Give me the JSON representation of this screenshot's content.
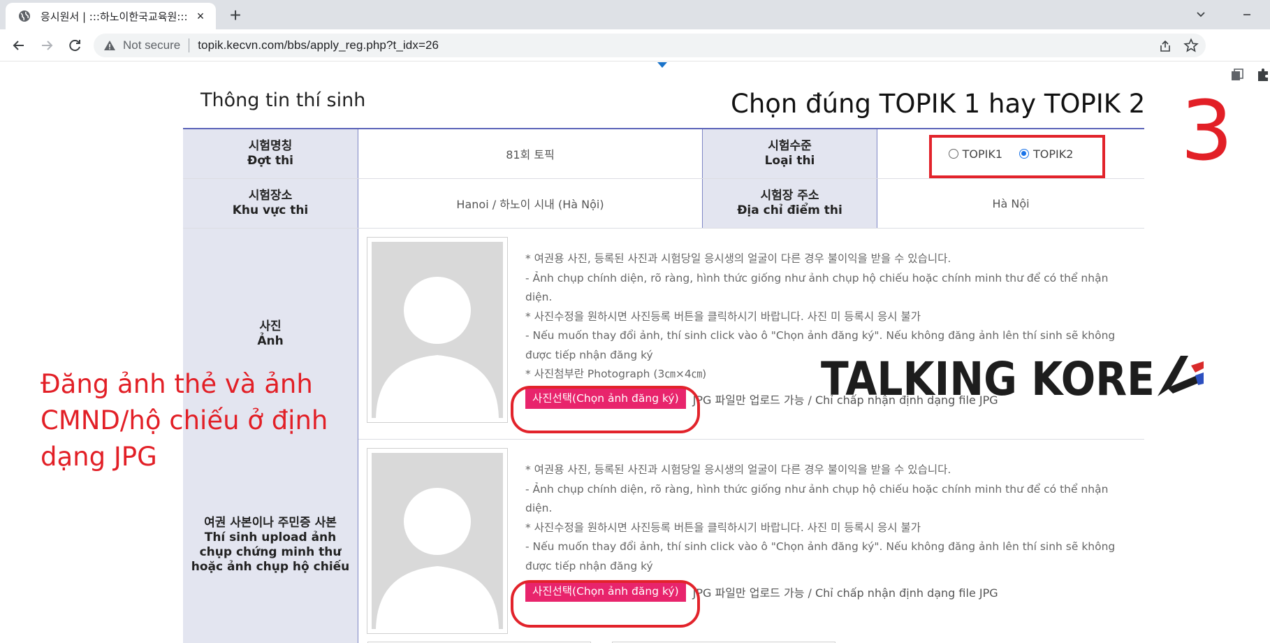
{
  "browser": {
    "tab_title": "응시원서 | :::하노이한국교육원:::",
    "tab_close": "×",
    "new_tab": "+",
    "not_secure": "Not secure",
    "url": "topik.kecvn.com/bbs/apply_reg.php?t_idx=26"
  },
  "page": {
    "section_title": "Thông tin thí sinh",
    "fields": {
      "exam_name_ko": "시험명칭",
      "exam_name_vi": "Đợt thi",
      "exam_name_value": "81회 토픽",
      "level_ko": "시험수준",
      "level_vi": "Loại thi",
      "level_options": [
        "TOPIK1",
        "TOPIK2"
      ],
      "level_selected": "TOPIK2",
      "area_ko": "시험장소",
      "area_vi": "Khu vực thi",
      "area_value": "Hanoi / 하노이 시내 (Hà Nội)",
      "address_ko": "시험장 주소",
      "address_vi": "Địa chỉ điểm thi",
      "address_value": "Hà Nội"
    },
    "photo_section": {
      "label_ko": "사진",
      "label_vi": "Ảnh",
      "notes": [
        "* 여권용 사진, 등록된 사진과 시험당일 응시생의 얼굴이 다른 경우 불이익을 받을 수 있습니다.",
        "- Ảnh chụp chính diện, rõ ràng, hình thức giống như ảnh chụp hộ chiếu hoặc chính minh thư để có thể nhận diện.",
        "* 사진수정을 원하시면 사진등록 버튼을 클릭하시기 바랍니다. 사진 미 등록시 응시 불가",
        "- Nếu muốn thay đổi ảnh, thí sinh click vào ô \"Chọn ảnh đăng ký\". Nếu không đăng ảnh lên thí sinh sẽ không được tiếp nhận đăng ký",
        "* 사진첨부란 Photograph (3㎝×4㎝)"
      ],
      "upload_button": "사진선택(Chọn ảnh đăng ký)",
      "upload_hint": "JPG 파일만 업로드 가능 / Chỉ chấp nhận định dạng file JPG"
    },
    "id_section": {
      "label_ko": "여권 사본이나 주민증 사본",
      "label_vi": "Thí sinh upload ảnh chụp chứng minh thư hoặc ảnh chụp hộ chiếu",
      "notes": [
        "* 여권용 사진, 등록된 사진과 시험당일 응시생의 얼굴이 다른 경우 불이익을 받을 수 있습니다.",
        "- Ảnh chụp chính diện, rõ ràng, hình thức giống như ảnh chụp hộ chiếu hoặc chính minh thư để có thể nhận diện.",
        "* 사진수정을 원하시면 사진등록 버튼을 클릭하시기 바랍니다. 사진 미 등록시 응시 불가",
        "- Nếu muốn thay đổi ảnh, thí sinh click vào ô \"Chọn ảnh đăng ký\". Nếu không đăng ảnh lên thí sinh sẽ không được tiếp nhận đăng ký"
      ],
      "upload_button": "사진선택(Chọn ảnh đăng ký)",
      "upload_hint": "JPG 파일만 업로드 가능 / Chỉ chấp nhận định dạng file JPG"
    }
  },
  "annotations": {
    "topik_hint": "Chọn đúng TOPIK 1 hay TOPIK 2",
    "step_number": "3",
    "upload_hint": "Đăng ảnh thẻ và ảnh CMND/hộ chiếu ở định dạng JPG",
    "logo_text": "TALKING KOREA"
  },
  "colors": {
    "accent_red": "#e2232b",
    "upload_pink": "#e8246c",
    "label_bg": "#e3e5f0",
    "table_border": "#5b63b8"
  }
}
